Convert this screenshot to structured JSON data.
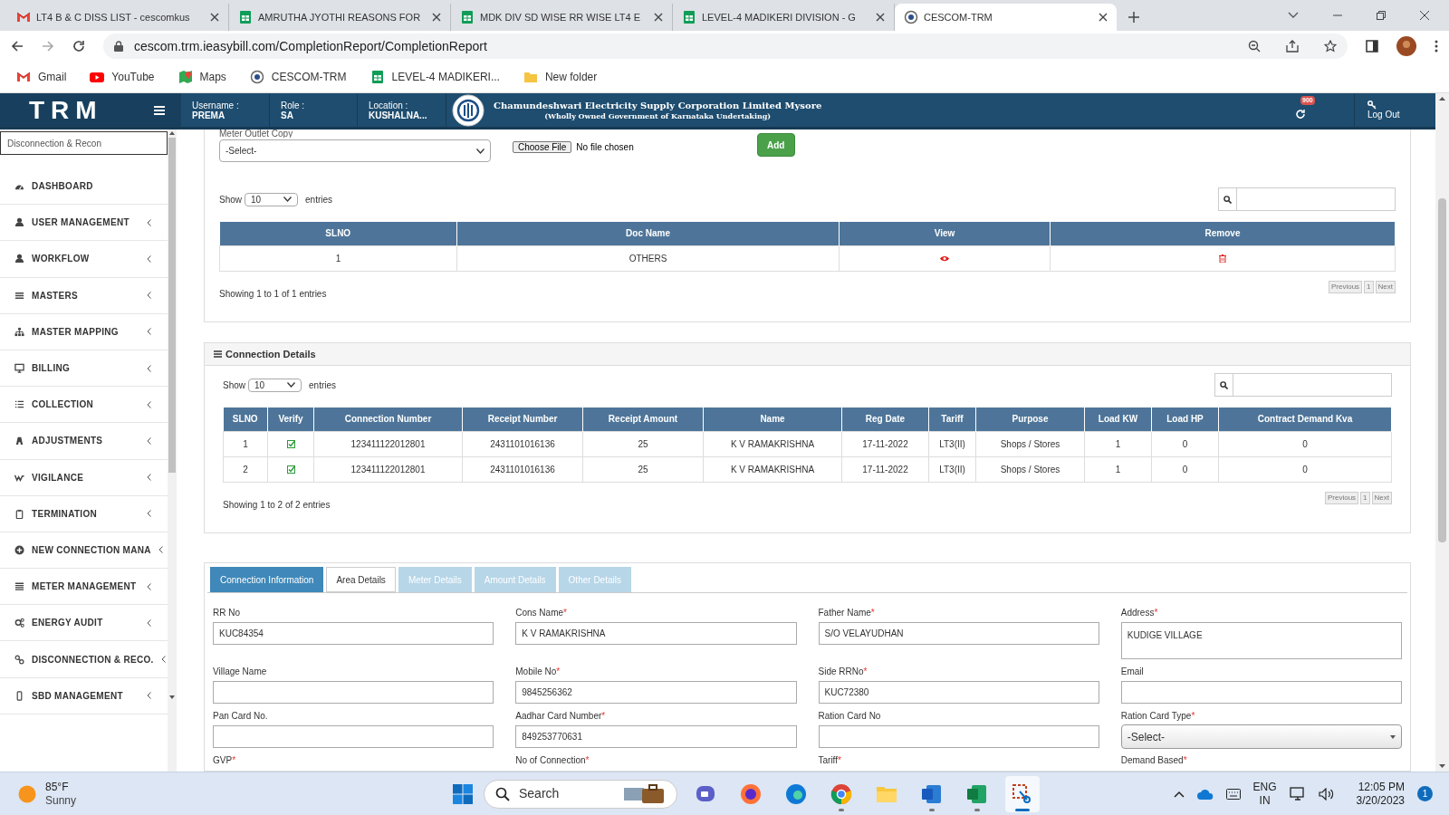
{
  "browser": {
    "tabs": [
      {
        "title": "LT4 B & C DISS LIST - cescomkus",
        "kind": "gmail",
        "selected": false
      },
      {
        "title": "AMRUTHA JYOTHI REASONS FOR",
        "kind": "sheets",
        "selected": false
      },
      {
        "title": "MDK DIV SD WISE RR WISE LT4 E",
        "kind": "sheets",
        "selected": false
      },
      {
        "title": "LEVEL-4 MADIKERI DIVISION - G",
        "kind": "sheets",
        "selected": false
      },
      {
        "title": "CESCOM-TRM",
        "kind": "site",
        "selected": true
      }
    ],
    "url": "cescom.trm.ieasybill.com/CompletionReport/CompletionReport",
    "bookmarks": [
      {
        "label": "Gmail",
        "kind": "gmail"
      },
      {
        "label": "YouTube",
        "kind": "youtube"
      },
      {
        "label": "Maps",
        "kind": "maps"
      },
      {
        "label": "CESCOM-TRM",
        "kind": "site"
      },
      {
        "label": "LEVEL-4 MADIKERI...",
        "kind": "sheets"
      },
      {
        "label": "New folder",
        "kind": "folder"
      }
    ]
  },
  "header": {
    "logo": "TRM",
    "username_label": "Username :",
    "username": "PREMA",
    "role_label": "Role :",
    "role": "SA",
    "location_label": "Location :",
    "location": "KUSHALNA...",
    "org_name": "Chamundeshwari Electricity Supply Corporation Limited Mysore",
    "org_subtitle": "(Wholly Owned Government of Karnataka Undertaking)",
    "notification_count": "900",
    "logout": "Log Out"
  },
  "sidebar": {
    "search": "Disconnection & Recon",
    "items": [
      {
        "label": "DASHBOARD",
        "has_submenu": false
      },
      {
        "label": "USER MANAGEMENT",
        "has_submenu": true
      },
      {
        "label": "WORKFLOW",
        "has_submenu": true
      },
      {
        "label": "MASTERS",
        "has_submenu": true
      },
      {
        "label": "MASTER MAPPING",
        "has_submenu": true
      },
      {
        "label": "BILLING",
        "has_submenu": true
      },
      {
        "label": "COLLECTION",
        "has_submenu": true
      },
      {
        "label": "ADJUSTMENTS",
        "has_submenu": true
      },
      {
        "label": "VIGILANCE",
        "has_submenu": true
      },
      {
        "label": "TERMINATION",
        "has_submenu": true
      },
      {
        "label": "NEW CONNECTION MANA",
        "has_submenu": true
      },
      {
        "label": "METER MANAGEMENT",
        "has_submenu": true
      },
      {
        "label": "ENERGY AUDIT",
        "has_submenu": true
      },
      {
        "label": "DISCONNECTION & RECO.",
        "has_submenu": true
      },
      {
        "label": "SBD MANAGEMENT",
        "has_submenu": true
      }
    ]
  },
  "documents": {
    "field_label": "Meter Outlet Copy",
    "select": "-Select-",
    "file_button": "Choose File",
    "file_status": "No file chosen",
    "add_button": "Add",
    "show_label": "Show",
    "page_size": "10",
    "entries_label": "entries",
    "columns": [
      "SLNO",
      "Doc Name",
      "View",
      "Remove"
    ],
    "rows": [
      {
        "slno": "1",
        "doc_name": "OTHERS"
      }
    ],
    "summary": "Showing 1 to 1 of 1 entries",
    "pagination": [
      "Previous",
      "1",
      "Next"
    ]
  },
  "connection_details": {
    "title": "Connection Details",
    "show_label": "Show",
    "page_size": "10",
    "entries_label": "entries",
    "columns": [
      "SLNO",
      "Verify",
      "Connection Number",
      "Receipt Number",
      "Receipt Amount",
      "Name",
      "Reg Date",
      "Tariff",
      "Purpose",
      "Load KW",
      "Load HP",
      "Contract Demand Kva"
    ],
    "rows": [
      {
        "verified": true,
        "cells": [
          "1",
          "",
          "123411122012801",
          "2431101016136",
          "25",
          "K V RAMAKRISHNA",
          "17-11-2022",
          "LT3(II)",
          "Shops / Stores",
          "1",
          "0",
          "0"
        ]
      },
      {
        "verified": true,
        "cells": [
          "2",
          "",
          "123411122012801",
          "2431101016136",
          "25",
          "K V RAMAKRISHNA",
          "17-11-2022",
          "LT3(II)",
          "Shops / Stores",
          "1",
          "0",
          "0"
        ]
      }
    ],
    "summary": "Showing 1 to 2 of 2 entries",
    "pagination": [
      "Previous",
      "1",
      "Next"
    ]
  },
  "form": {
    "tabs": [
      {
        "label": "Connection Information",
        "selected": true,
        "disabled": false
      },
      {
        "label": "Area Details",
        "selected": false,
        "disabled": false
      },
      {
        "label": "Meter Details",
        "selected": false,
        "disabled": true
      },
      {
        "label": "Amount Details",
        "selected": false,
        "disabled": true
      },
      {
        "label": "Other Details",
        "selected": false,
        "disabled": true
      }
    ],
    "fields": [
      {
        "label": "RR No",
        "kind": "input",
        "value": "KUC84354"
      },
      {
        "label": "Cons Name",
        "mark": "*",
        "kind": "input",
        "value": "K V RAMAKRISHNA"
      },
      {
        "label": "Father Name",
        "mark": "*",
        "kind": "input",
        "value": "S/O VELAYUDHAN"
      },
      {
        "label": "Address",
        "mark": "*",
        "kind": "textarea",
        "value": "KUDIGE VILLAGE"
      },
      {
        "label": "Village Name",
        "kind": "input"
      },
      {
        "label": "Mobile No",
        "mark": "*",
        "kind": "input",
        "value": "9845256362"
      },
      {
        "label": "Side RRNo",
        "mark": "*",
        "kind": "input",
        "value": "KUC72380"
      },
      {
        "label": "Email",
        "kind": "input"
      },
      {
        "label": "Pan Card No.",
        "kind": "input"
      },
      {
        "label": "Aadhar Card Number",
        "mark": "*",
        "kind": "input",
        "value": "849253770631"
      },
      {
        "label": "Ration Card No",
        "kind": "input"
      },
      {
        "label": "Ration Card Type",
        "mark": "*",
        "kind": "select",
        "value": "-Select-"
      },
      {
        "label": "GVP",
        "mark": "*",
        "kind": "label_only"
      },
      {
        "label": "No of Connection",
        "mark": "*",
        "kind": "label_only"
      },
      {
        "label": "Tariff",
        "mark": "*",
        "kind": "label_only"
      },
      {
        "label": "Demand Based",
        "mark": "*",
        "kind": "label_only"
      }
    ]
  },
  "taskbar": {
    "temperature": "85°F",
    "weather": "Sunny",
    "search": "Search",
    "apps": [
      {
        "running": false,
        "active": false
      },
      {
        "running": false,
        "active": false
      },
      {
        "running": false,
        "active": false
      },
      {
        "running": true,
        "active": false
      },
      {
        "running": false,
        "active": false
      },
      {
        "running": true,
        "active": false
      },
      {
        "running": true,
        "active": false
      },
      {
        "running": true,
        "active": true
      }
    ],
    "language": "ENG",
    "region": "IN",
    "time": "12:05 PM",
    "date": "3/20/2023",
    "notifications": "1"
  }
}
